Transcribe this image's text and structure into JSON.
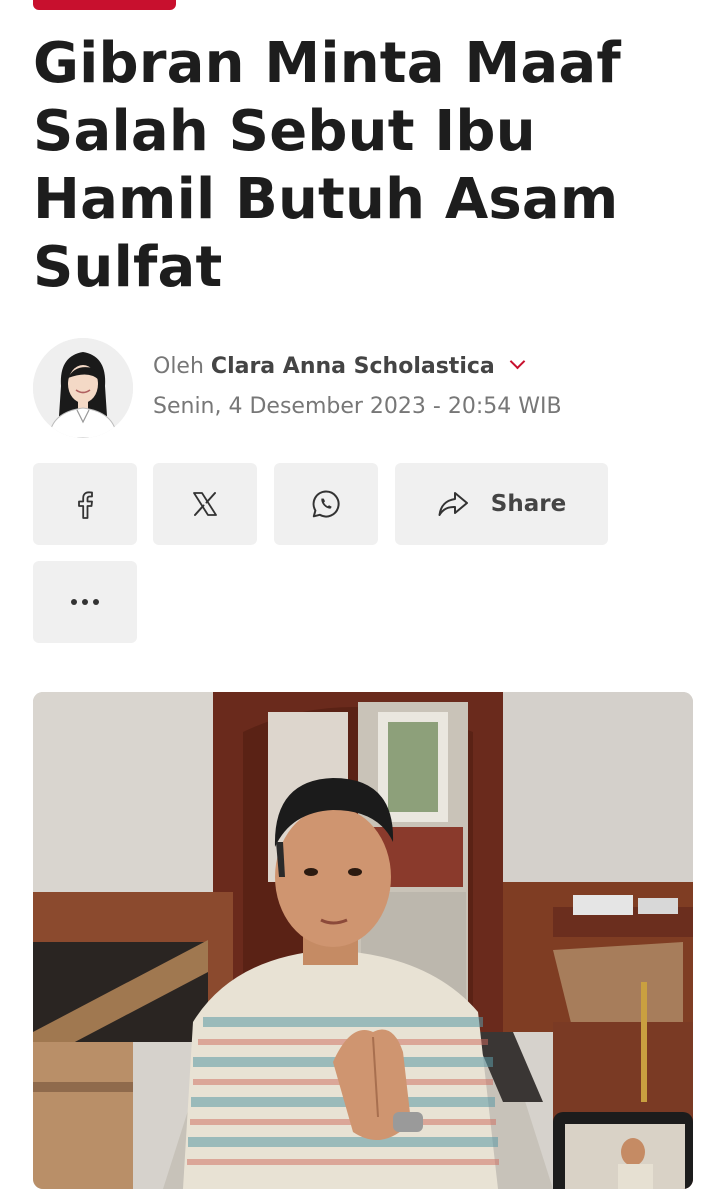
{
  "article": {
    "headline": "Gibran Minta Maaf Salah Sebut Ibu Hamil Butuh Asam Sulfat",
    "byline_prefix": "Oleh",
    "author": "Clara Anna Scholastica",
    "date": "Senin, 4 Desember 2023 - 20:54 WIB"
  },
  "share": {
    "buttons": [
      {
        "icon": "facebook-icon"
      },
      {
        "icon": "x-icon"
      },
      {
        "icon": "whatsapp-icon"
      },
      {
        "icon": "share-arrow-icon",
        "label": "Share"
      },
      {
        "icon": "more-icon"
      }
    ]
  },
  "colors": {
    "accent": "#c8102e",
    "button_bg": "#f0f0f0",
    "text": "#1d1d1d",
    "muted": "#777777"
  }
}
